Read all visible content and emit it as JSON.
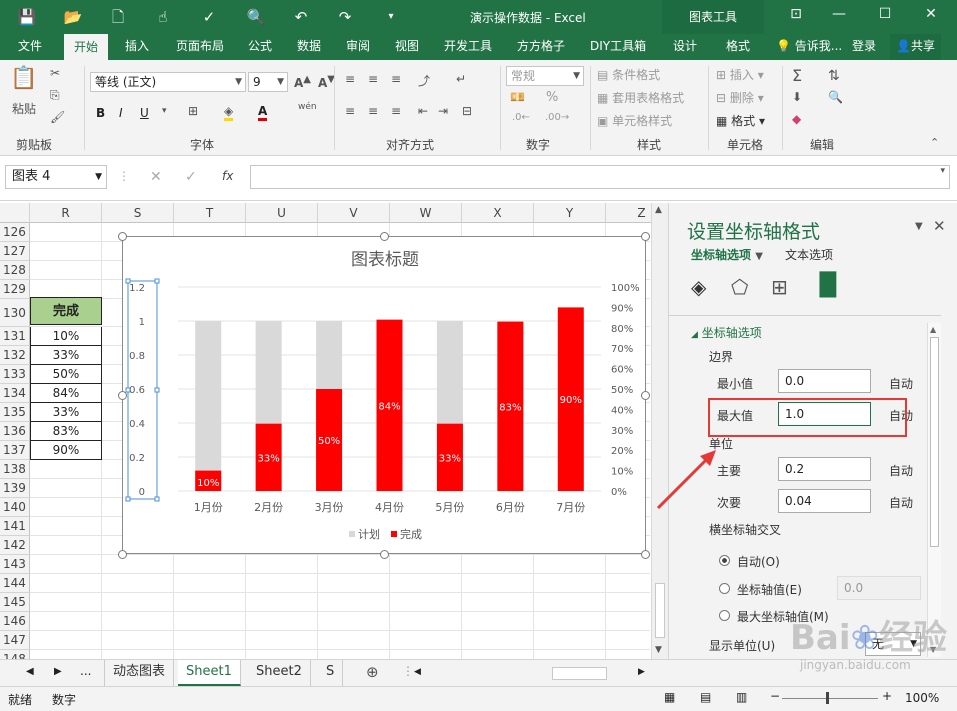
{
  "window": {
    "title": "演示操作数据 - Excel",
    "context_tab": "图表工具"
  },
  "ribbon_tabs": [
    "文件",
    "开始",
    "插入",
    "页面布局",
    "公式",
    "数据",
    "审阅",
    "视图",
    "开发工具",
    "方方格子",
    "DIY工具箱",
    "设计",
    "格式"
  ],
  "ribbon_right": {
    "tell_me": "告诉我...",
    "signin": "登录",
    "share": "共享"
  },
  "ribbon": {
    "clipboard": {
      "label": "剪贴板",
      "paste": "粘贴"
    },
    "font": {
      "label": "字体",
      "name": "等线 (正文)",
      "size": "9",
      "wen": "wén"
    },
    "alignment": {
      "label": "对齐方式"
    },
    "number": {
      "label": "数字",
      "format": "常规"
    },
    "styles": {
      "label": "样式",
      "cond": "条件格式",
      "table": "套用表格格式",
      "cell": "单元格样式"
    },
    "cells": {
      "label": "单元格",
      "insert": "插入",
      "delete": "删除",
      "format": "格式"
    },
    "editing": {
      "label": "编辑"
    }
  },
  "formula_bar": {
    "name_box": "图表 4",
    "fx": "fx",
    "content": ""
  },
  "columns": [
    "R",
    "S",
    "T",
    "U",
    "V",
    "W",
    "X",
    "Y",
    "Z"
  ],
  "rows": [
    "126",
    "127",
    "128",
    "129",
    "130",
    "131",
    "132",
    "133",
    "134",
    "135",
    "136",
    "137",
    "138",
    "139",
    "140",
    "141",
    "142",
    "143",
    "144",
    "145",
    "146",
    "147",
    "148"
  ],
  "table": {
    "header": "完成",
    "values": [
      "10%",
      "33%",
      "50%",
      "84%",
      "33%",
      "83%",
      "90%"
    ],
    "header_color": "#a9d08e"
  },
  "chart_data": {
    "type": "bar",
    "title": "图表标题",
    "categories": [
      "1月份",
      "2月份",
      "3月份",
      "4月份",
      "5月份",
      "6月份",
      "7月份"
    ],
    "series": [
      {
        "name": "计划",
        "values": [
          1,
          1,
          1,
          1,
          1,
          1,
          1
        ],
        "color": "#d9d9d9",
        "axis": "left"
      },
      {
        "name": "完成",
        "values": [
          0.1,
          0.33,
          0.5,
          0.84,
          0.33,
          0.83,
          0.9
        ],
        "color": "#ff0000",
        "axis": "right",
        "labels": [
          "10%",
          "33%",
          "50%",
          "84%",
          "33%",
          "83%",
          "90%"
        ]
      }
    ],
    "left_axis": {
      "ylim": [
        0,
        1.2
      ],
      "ticks": [
        "0",
        "0.2",
        "0.4",
        "0.6",
        "0.8",
        "1",
        "1.2"
      ]
    },
    "right_axis": {
      "ylim": [
        0,
        1.0
      ],
      "ticks": [
        "0%",
        "10%",
        "20%",
        "30%",
        "40%",
        "50%",
        "60%",
        "70%",
        "80%",
        "90%",
        "100%"
      ]
    },
    "legend": "bottom",
    "grid": true
  },
  "panel": {
    "title": "设置坐标轴格式",
    "tab1": "坐标轴选项",
    "tab2": "文本选项",
    "section": "坐标轴选项",
    "bounds": "边界",
    "min_label": "最小值",
    "min_value": "0.0",
    "max_label": "最大值",
    "max_value": "1.0",
    "units": "单位",
    "major_label": "主要",
    "major_value": "0.2",
    "minor_label": "次要",
    "minor_value": "0.04",
    "auto": "自动",
    "cross": "横坐标轴交叉",
    "cross_auto": "自动(O)",
    "cross_value": "坐标轴值(E)",
    "cross_value_input": "0.0",
    "cross_max": "最大坐标轴值(M)",
    "display_units": "显示单位(U)",
    "display_units_value": "无"
  },
  "sheet_tabs": [
    "动态图表",
    "Sheet1",
    "Sheet2",
    "S"
  ],
  "sheet_more": "...",
  "status": {
    "ready": "就绪",
    "num": "数字",
    "zoom": "100%"
  },
  "watermark": "jingyan.baidu.com",
  "accent": "#217346",
  "highlight": "#e53935"
}
